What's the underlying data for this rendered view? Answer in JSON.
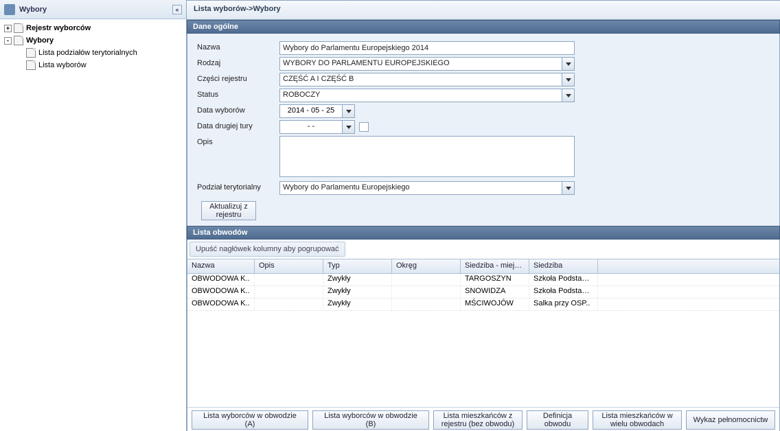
{
  "sidebar": {
    "title": "Wybory",
    "items": [
      {
        "label": "Rejestr wyborców",
        "bold": true,
        "icon": "doc",
        "pm": "+",
        "indent": 0
      },
      {
        "label": "Wybory",
        "bold": true,
        "icon": "doc",
        "pm": "-",
        "indent": 0
      },
      {
        "label": "Lista podziałów terytorialnych",
        "bold": false,
        "icon": "doc",
        "pm": "",
        "indent": 2
      },
      {
        "label": "Lista wyborów",
        "bold": false,
        "icon": "doc",
        "pm": "",
        "indent": 2
      }
    ]
  },
  "breadcrumb": "Lista wyborów->Wybory",
  "sections": {
    "general": "Dane ogólne",
    "obwody": "Lista obwodów"
  },
  "form": {
    "nazwa_label": "Nazwa",
    "nazwa_value": "Wybory do Parlamentu Europejskiego 2014",
    "rodzaj_label": "Rodzaj",
    "rodzaj_value": "WYBORY DO PARLAMENTU EUROPEJSKIEGO",
    "czesci_label": "Części rejestru",
    "czesci_value": "CZĘŚĆ A I CZĘŚĆ B",
    "status_label": "Status",
    "status_value": "ROBOCZY",
    "data_wyborow_label": "Data wyborów",
    "data_wyborow_value": "2014 - 05 - 25",
    "data_tura2_label": "Data drugiej tury",
    "data_tura2_value": "-   -",
    "opis_label": "Opis",
    "opis_value": "",
    "podzial_label": "Podział terytorialny",
    "podzial_value": "Wybory do Parlamentu Europejskiego"
  },
  "buttons": {
    "update": "Aktualizuj z rejestru"
  },
  "grid": {
    "group_hint": "Upuść nagłówek kolumny aby pogrupować",
    "headers": {
      "nazwa": "Nazwa",
      "opis": "Opis",
      "typ": "Typ",
      "okreg": "Okręg",
      "siedzibam": "Siedziba - miejsc..",
      "siedziba": "Siedziba"
    },
    "rows": [
      {
        "nazwa": "OBWODOWA K..",
        "opis": "",
        "typ": "Zwykły",
        "okreg": "",
        "siedzibam": "TARGOSZYN",
        "siedziba": "Szkoła Podstawo.."
      },
      {
        "nazwa": "OBWODOWA K..",
        "opis": "",
        "typ": "Zwykły",
        "okreg": "",
        "siedzibam": "SNOWIDZA",
        "siedziba": "Szkoła Podstawo.."
      },
      {
        "nazwa": "OBWODOWA K..",
        "opis": "",
        "typ": "Zwykły",
        "okreg": "",
        "siedzibam": "MŚCIWOJÓW",
        "siedziba": "Salka przy OSP.."
      }
    ]
  },
  "footer": {
    "b1": "Lista wyborców w obwodzie (A)",
    "b2": "Lista wyborców w obwodzie (B)",
    "b3": "Lista mieszkańców z rejestru (bez obwodu)",
    "b4": "Definicja obwodu",
    "b5": "Lista mieszkańców w wielu obwodach",
    "b6": "Wykaz pełnomocnictw"
  }
}
